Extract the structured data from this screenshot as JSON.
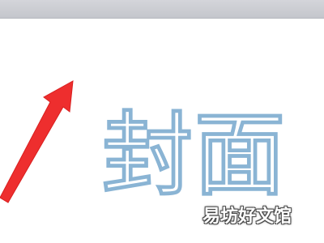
{
  "window": {
    "top_bar_color": "#c8cacf"
  },
  "slide": {
    "wordart_text": "封面",
    "wordart_outline_color": "#8ab4d4",
    "arrow_color": "#ee2e2e"
  },
  "watermark": {
    "text": "易坊好文馆"
  }
}
